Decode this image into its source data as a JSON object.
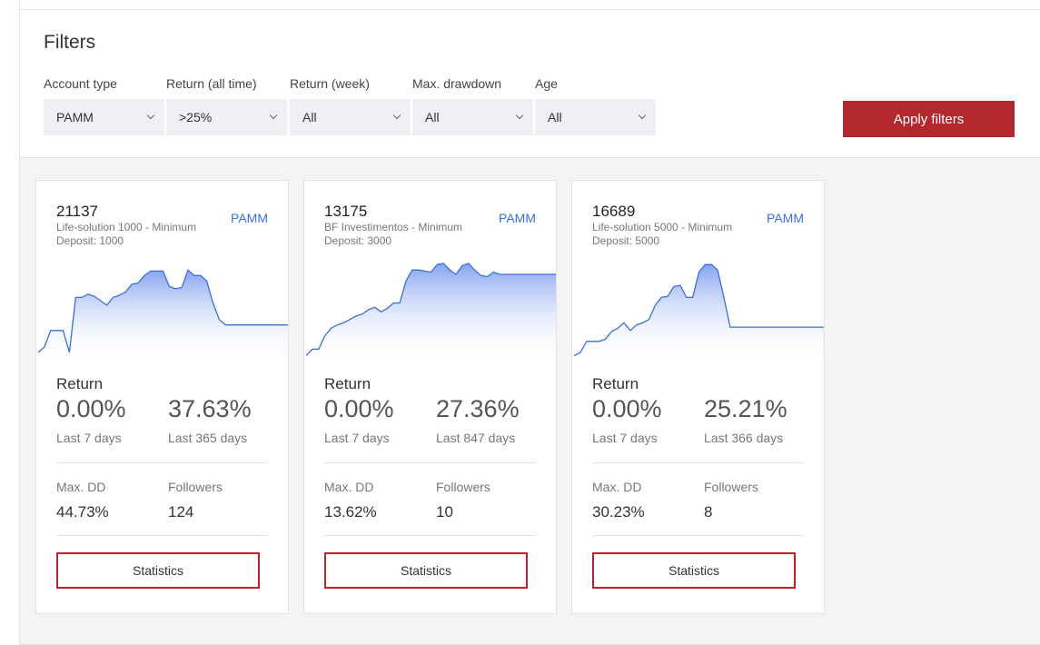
{
  "filters": {
    "title": "Filters",
    "groups": [
      {
        "label": "Account type",
        "value": "PAMM"
      },
      {
        "label": "Return (all time)",
        "value": ">25%"
      },
      {
        "label": "Return (week)",
        "value": "All"
      },
      {
        "label": "Max. drawdown",
        "value": "All"
      },
      {
        "label": "Age",
        "value": "All"
      }
    ],
    "apply_label": "Apply filters"
  },
  "colors": {
    "accent_red": "#b3282d",
    "link_blue": "#3a6fd8",
    "chart_line": "#3a6fd8",
    "chart_fill_top": "#7f9ef0",
    "select_bg": "#eef0f3"
  },
  "cards": [
    {
      "id": "21137",
      "name": "Life-solution 1000 - Minimum Deposit: 1000",
      "type": "PAMM",
      "return_title": "Return",
      "return_week": "0.00%",
      "return_week_label": "Last 7 days",
      "return_total": "37.63%",
      "return_total_label": "Last 365 days",
      "maxdd_label": "Max. DD",
      "maxdd": "44.73%",
      "followers_label": "Followers",
      "followers": "124",
      "stats_label": "Statistics",
      "sparkline": [
        5,
        10,
        25,
        25,
        25,
        5,
        55,
        55,
        58,
        56,
        52,
        48,
        55,
        57,
        60,
        67,
        68,
        75,
        79,
        79,
        79,
        65,
        63,
        64,
        80,
        75,
        75,
        70,
        50,
        35,
        30,
        30,
        30,
        30,
        30,
        30,
        30,
        30,
        30,
        30,
        30
      ]
    },
    {
      "id": "13175",
      "name": "BF Investimentos - Minimum Deposit: 3000",
      "type": "PAMM",
      "return_title": "Return",
      "return_week": "0.00%",
      "return_week_label": "Last 7 days",
      "return_total": "27.36%",
      "return_total_label": "Last 847 days",
      "maxdd_label": "Max. DD",
      "maxdd": "13.62%",
      "followers_label": "Followers",
      "followers": "10",
      "stats_label": "Statistics",
      "sparkline": [
        2,
        8,
        8,
        20,
        27,
        30,
        32,
        35,
        38,
        40,
        44,
        46,
        42,
        45,
        50,
        50,
        70,
        80,
        80,
        79,
        78,
        85,
        86,
        80,
        76,
        84,
        86,
        80,
        75,
        74,
        78,
        76,
        76,
        76,
        76,
        76,
        76,
        76,
        76,
        76,
        76
      ]
    },
    {
      "id": "16689",
      "name": "Life-solution 5000 - Minimum Deposit: 5000",
      "type": "PAMM",
      "return_title": "Return",
      "return_week": "0.00%",
      "return_week_label": "Last 7 days",
      "return_total": "25.21%",
      "return_total_label": "Last 366 days",
      "maxdd_label": "Max. DD",
      "maxdd": "30.23%",
      "followers_label": "Followers",
      "followers": "8",
      "stats_label": "Statistics",
      "sparkline": [
        2,
        5,
        15,
        15,
        15,
        17,
        24,
        27,
        32,
        25,
        30,
        32,
        35,
        48,
        55,
        56,
        65,
        66,
        55,
        55,
        78,
        85,
        85,
        80,
        55,
        28,
        28,
        28,
        28,
        28,
        28,
        28,
        28,
        28,
        28,
        28,
        28,
        28,
        28,
        28,
        28
      ]
    }
  ]
}
